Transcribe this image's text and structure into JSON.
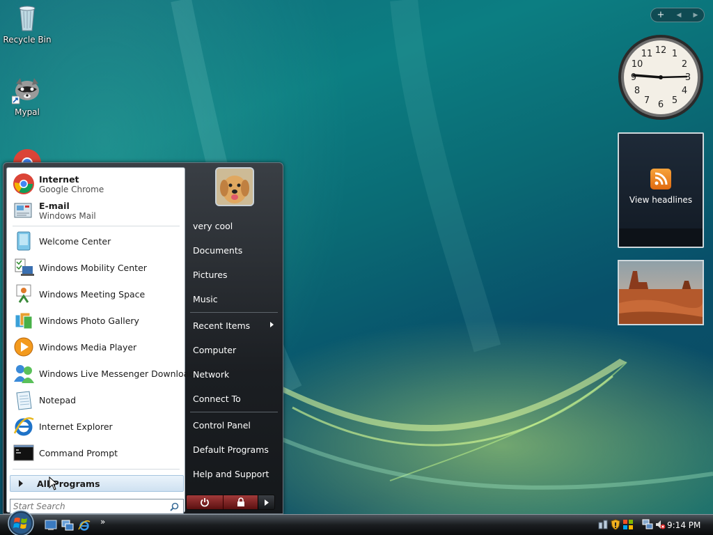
{
  "desktop": {
    "icons": [
      {
        "label": "Recycle Bin"
      },
      {
        "label": "Mypal"
      }
    ]
  },
  "gadgets": {
    "controls": {
      "add": "+",
      "prev": "◀",
      "next": "▶"
    },
    "clock": {
      "numerals": [
        "12",
        "1",
        "2",
        "3",
        "4",
        "5",
        "6",
        "7",
        "8",
        "9",
        "10",
        "11"
      ]
    },
    "headlines": {
      "label": "View headlines"
    }
  },
  "start_menu": {
    "pinned": [
      {
        "title": "Internet",
        "subtitle": "Google Chrome"
      },
      {
        "title": "E-mail",
        "subtitle": "Windows Mail"
      }
    ],
    "recent": [
      {
        "label": "Welcome Center"
      },
      {
        "label": "Windows Mobility Center"
      },
      {
        "label": "Windows Meeting Space"
      },
      {
        "label": "Windows Photo Gallery"
      },
      {
        "label": "Windows Media Player"
      },
      {
        "label": "Windows Live Messenger Download"
      },
      {
        "label": "Notepad"
      },
      {
        "label": "Internet Explorer"
      },
      {
        "label": "Command Prompt"
      }
    ],
    "all_programs": "All Programs",
    "search_placeholder": "Start Search",
    "right": [
      {
        "label": "very cool"
      },
      {
        "label": "Documents"
      },
      {
        "label": "Pictures"
      },
      {
        "label": "Music"
      },
      {
        "label": "Recent Items"
      },
      {
        "label": "Computer"
      },
      {
        "label": "Network"
      },
      {
        "label": "Connect To"
      },
      {
        "label": "Control Panel"
      },
      {
        "label": "Default Programs"
      },
      {
        "label": "Help and Support"
      }
    ]
  },
  "taskbar": {
    "quick_launch_more": "»",
    "time": "9:14 PM"
  },
  "colors": {
    "accent": "#1f6fbf",
    "power_red": "#8a2020"
  }
}
